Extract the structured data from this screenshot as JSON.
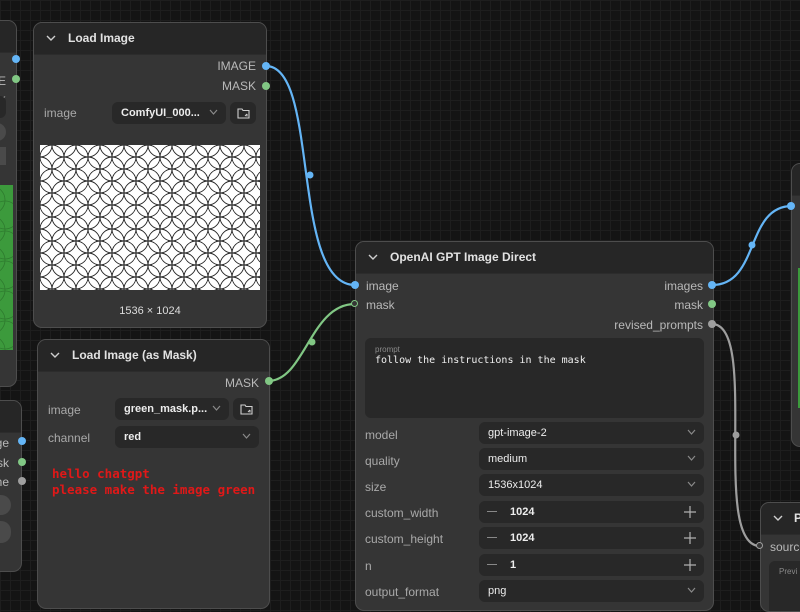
{
  "left_node_top": {
    "outputs": [
      "E",
      "K"
    ]
  },
  "left_node_bottom": {
    "outputs": [
      "ge",
      "sk",
      "ne"
    ]
  },
  "load_image": {
    "title": "Load Image",
    "outputs": {
      "image": "IMAGE",
      "mask": "MASK"
    },
    "image_label": "image",
    "image_value": "ComfyUI_000...",
    "preview_caption": "1536 × 1024"
  },
  "load_image_mask": {
    "title": "Load Image (as Mask)",
    "output_mask": "MASK",
    "image_label": "image",
    "image_value": "green_mask.p...",
    "channel_label": "channel",
    "channel_value": "red",
    "mask_text_line1": "hello chatgpt",
    "mask_text_line2": "please make the image green",
    "mask_text_color": "#e01818"
  },
  "gpt_node": {
    "title": "OpenAI GPT Image Direct",
    "inputs": {
      "image": "image",
      "mask": "mask"
    },
    "outputs": {
      "images": "images",
      "mask": "mask",
      "revised_prompts": "revised_prompts"
    },
    "prompt_label": "prompt",
    "prompt_value": "follow the instructions in the mask",
    "widgets": {
      "model": {
        "label": "model",
        "value": "gpt-image-2"
      },
      "quality": {
        "label": "quality",
        "value": "medium"
      },
      "size": {
        "label": "size",
        "value": "1536x1024"
      },
      "custom_width": {
        "label": "custom_width",
        "value": "1024"
      },
      "custom_height": {
        "label": "custom_height",
        "value": "1024"
      },
      "n": {
        "label": "n",
        "value": "1"
      },
      "output_format": {
        "label": "output_format",
        "value": "png"
      }
    }
  },
  "right_node_bottom": {
    "title": "P",
    "input_label": "source",
    "preview_label": "Previ"
  },
  "colors": {
    "image_port": "#64b5f6",
    "mask_port": "#81c784",
    "string_port": "#9e9e9e",
    "node_bg": "#353535",
    "canvas_bg": "#141414"
  }
}
